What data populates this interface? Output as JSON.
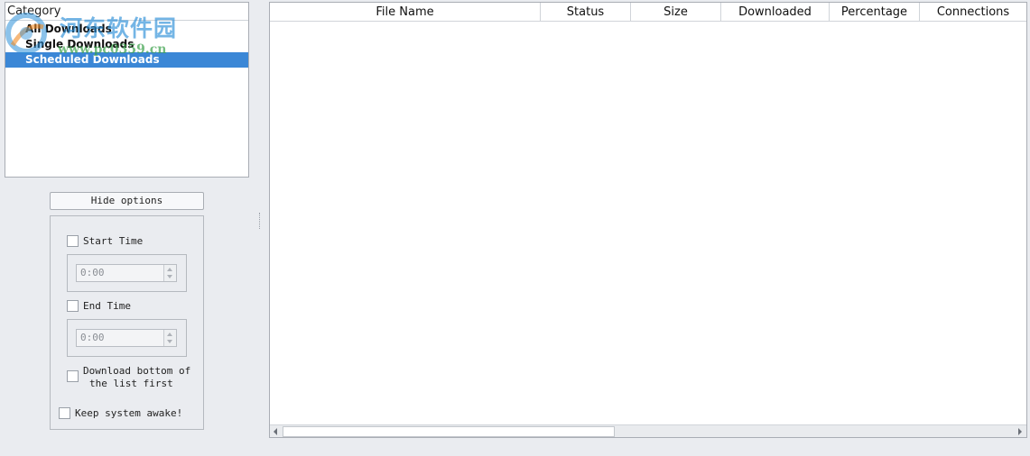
{
  "sidebar": {
    "header": "Category",
    "items": [
      {
        "label": "All Downloads",
        "selected": false
      },
      {
        "label": "Single Downloads",
        "selected": false
      },
      {
        "label": "Scheduled Downloads",
        "selected": true
      }
    ]
  },
  "watermark": {
    "text": "河东软件园",
    "url": "www.pc0359.cn"
  },
  "options": {
    "hide_label": "Hide options",
    "start_time": {
      "label": "Start Time",
      "checked": false,
      "value": "0:00"
    },
    "end_time": {
      "label": "End Time",
      "checked": false,
      "value": "0:00"
    },
    "bottom_first": {
      "line1": "Download bottom of",
      "line2": "the list first",
      "checked": false
    },
    "keep_awake": {
      "label": "Keep system awake!",
      "checked": false
    }
  },
  "table": {
    "columns": [
      "File Name",
      "Status",
      "Size",
      "Downloaded",
      "Percentage",
      "Connections"
    ],
    "rows": []
  },
  "colors": {
    "selection": "#3b87d6",
    "background": "#eaecf0"
  }
}
